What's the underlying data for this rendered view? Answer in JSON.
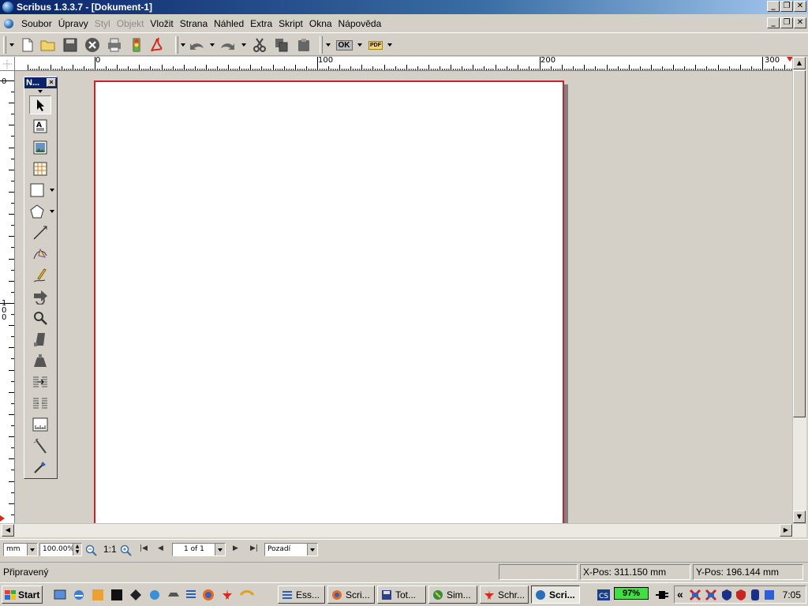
{
  "window": {
    "title": "Scribus 1.3.3.7 - [Dokument-1]"
  },
  "menu": [
    {
      "label": "Soubor",
      "enabled": true
    },
    {
      "label": "Úpravy",
      "enabled": true
    },
    {
      "label": "Styl",
      "enabled": false
    },
    {
      "label": "Objekt",
      "enabled": false
    },
    {
      "label": "Vložit",
      "enabled": true
    },
    {
      "label": "Strana",
      "enabled": true
    },
    {
      "label": "Náhled",
      "enabled": true
    },
    {
      "label": "Extra",
      "enabled": true
    },
    {
      "label": "Skript",
      "enabled": true
    },
    {
      "label": "Okna",
      "enabled": true
    },
    {
      "label": "Nápověda",
      "enabled": true
    }
  ],
  "toolbar": {
    "preflight_label": "OK",
    "pdf_label": "PDF"
  },
  "rulers": {
    "horizontal_labels": [
      "0",
      "100",
      "200",
      "300"
    ],
    "vertical_labels": [
      "0",
      "100"
    ]
  },
  "toolbox": {
    "title": "N...",
    "close": "×"
  },
  "bottombar": {
    "unit": "mm",
    "zoom": "100.00%",
    "ratio": "1:1",
    "page": "1 of 1",
    "layer": "Pozadí"
  },
  "status": {
    "message": "Připravený",
    "xpos_label": "X-Pos:",
    "xpos_value": "311.150 mm",
    "ypos_label": "Y-Pos:",
    "ypos_value": "196.144 mm"
  },
  "taskbar": {
    "start": "Start",
    "tasks": [
      {
        "label": "Ess..."
      },
      {
        "label": "Scri..."
      },
      {
        "label": "Tot..."
      },
      {
        "label": "Sim..."
      },
      {
        "label": "Schr..."
      },
      {
        "label": "Scri..."
      }
    ],
    "battery": "97%",
    "tray_chevron": "«",
    "clock": "7:05"
  },
  "colors": {
    "page_border": "#c8232c",
    "titlebar": "#0a246a",
    "battery": "#3ee23e"
  }
}
